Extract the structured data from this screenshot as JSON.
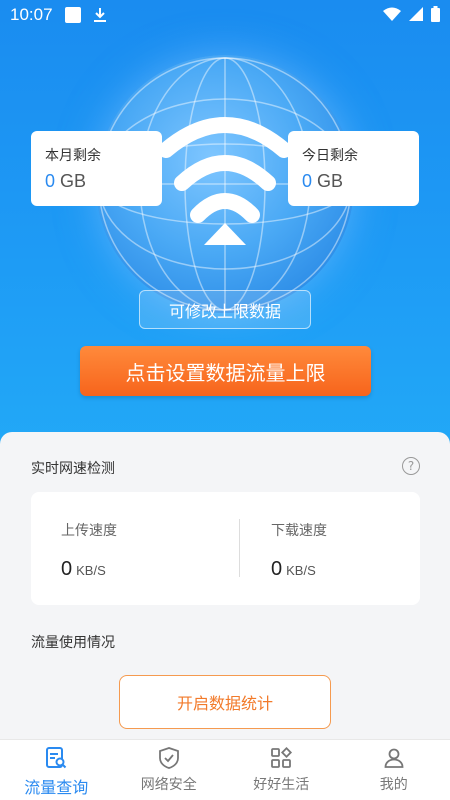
{
  "status_bar": {
    "time": "10:07"
  },
  "hero": {
    "month_card": {
      "label": "本月剩余",
      "value": "0",
      "unit": "GB"
    },
    "today_card": {
      "label": "今日剩余",
      "value": "0",
      "unit": "GB"
    },
    "edit_limit_label": "可修改上限数据",
    "set_limit_button": "点击设置数据流量上限"
  },
  "speed": {
    "title": "实时网速检测",
    "help": "?",
    "upload": {
      "label": "上传速度",
      "value": "0",
      "unit": "KB/S"
    },
    "download": {
      "label": "下载速度",
      "value": "0",
      "unit": "KB/S"
    }
  },
  "usage": {
    "title": "流量使用情况",
    "button": "开启数据统计"
  },
  "tabbar": {
    "items": [
      {
        "label": "流量查询",
        "icon": "traffic-query-icon",
        "active": true
      },
      {
        "label": "网络安全",
        "icon": "shield-icon",
        "active": false
      },
      {
        "label": "好好生活",
        "icon": "apps-icon",
        "active": false
      },
      {
        "label": "我的",
        "icon": "user-icon",
        "active": false
      }
    ]
  },
  "colors": {
    "accent": "#2a8af0",
    "orange": "#f7641c"
  }
}
